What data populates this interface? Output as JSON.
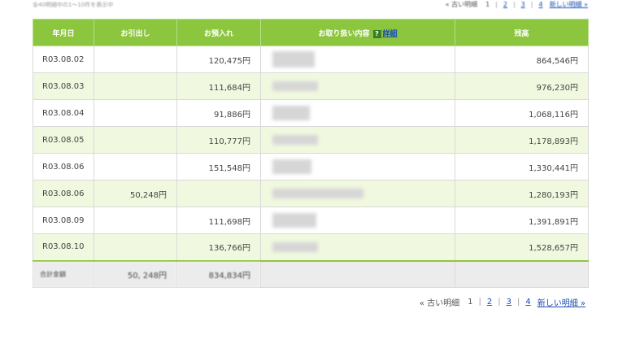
{
  "summary_text": "全40明細中の1～10件を表示中",
  "pager": {
    "older": "« 古い明細",
    "pages": [
      "1",
      "2",
      "3",
      "4"
    ],
    "current_page": "1",
    "newer": "新しい明細 »"
  },
  "table": {
    "headers": {
      "date": "年月日",
      "withdrawal": "お引出し",
      "deposit": "お預入れ",
      "description": "お取り扱い内容",
      "detail_link": "詳細",
      "balance": "残高"
    },
    "rows": [
      {
        "date": "R03.08.02",
        "withdrawal": "",
        "deposit": "120,475円",
        "balance": "864,546円"
      },
      {
        "date": "R03.08.03",
        "withdrawal": "",
        "deposit": "111,684円",
        "balance": "976,230円"
      },
      {
        "date": "R03.08.04",
        "withdrawal": "",
        "deposit": "91,886円",
        "balance": "1,068,116円"
      },
      {
        "date": "R03.08.05",
        "withdrawal": "",
        "deposit": "110,777円",
        "balance": "1,178,893円"
      },
      {
        "date": "R03.08.06",
        "withdrawal": "",
        "deposit": "151,548円",
        "balance": "1,330,441円"
      },
      {
        "date": "R03.08.06",
        "withdrawal": "50,248円",
        "deposit": "",
        "balance": "1,280,193円"
      },
      {
        "date": "R03.08.09",
        "withdrawal": "",
        "deposit": "111,698円",
        "balance": "1,391,891円"
      },
      {
        "date": "R03.08.10",
        "withdrawal": "",
        "deposit": "136,766円",
        "balance": "1,528,657円"
      }
    ],
    "total": {
      "label": "合計金額",
      "withdrawal": "50, 248円",
      "deposit": "834,834円"
    }
  },
  "colors": {
    "header_green": "#8cc63e",
    "alt_row": "#f0f9df",
    "link_blue": "#1a4fb5"
  }
}
